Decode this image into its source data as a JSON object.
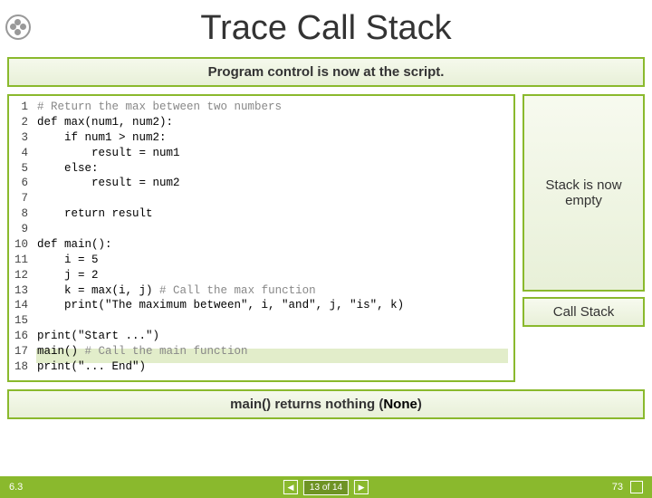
{
  "title": "Trace Call Stack",
  "banner_text": "Program control is now at the script.",
  "line_numbers": "1\n2\n3\n4\n5\n6\n7\n8\n9\n10\n11\n12\n13\n14\n15\n16\n17\n18",
  "code_lines": {
    "l1": "# Return the max between two numbers",
    "l2": "def max(num1, num2):",
    "l3": "    if num1 > num2:",
    "l4": "        result = num1",
    "l5": "    else:",
    "l6": "        result = num2",
    "l7": "",
    "l8": "    return result",
    "l9": "",
    "l10": "def main():",
    "l11": "    i = 5",
    "l12": "    j = 2",
    "l13a": "    k = max(i, j) ",
    "l13b": "# Call the max function",
    "l14": "    print(\"The maximum between\", i, \"and\", j, \"is\", k)",
    "l15": "",
    "l16": "print(\"Start ...\")",
    "l17a": "main() ",
    "l17b": "# Call the main function",
    "l18": "print(\"... End\")"
  },
  "stack_empty_text": "Stack is now empty",
  "stack_label": "Call Stack",
  "footer_text_a": "main() returns nothing (",
  "footer_none": "None",
  "footer_text_b": ")",
  "section_number": "6.3",
  "page_indicator": "13 of 14",
  "page_number": "73",
  "nav_prev_glyph": "◀",
  "nav_next_glyph": "▶"
}
